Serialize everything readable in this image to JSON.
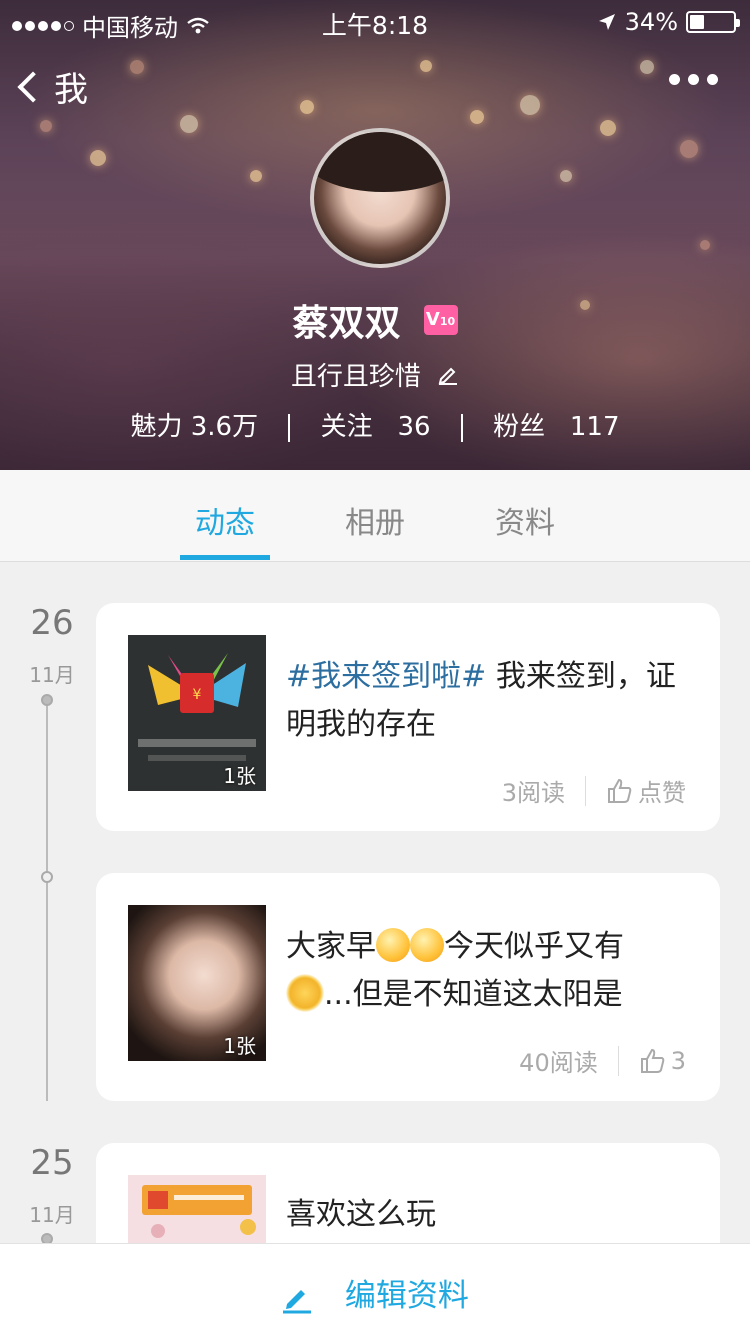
{
  "status_bar": {
    "carrier": "中国移动",
    "time": "上午8:18",
    "battery": "34%",
    "battery_level": 0.34
  },
  "nav": {
    "back_label": "我"
  },
  "profile": {
    "name": "蔡双双",
    "vip_badge": "V10",
    "signature": "且行且珍惜",
    "stats": [
      {
        "label": "魅力",
        "value": "3.6万"
      },
      {
        "label": "关注",
        "value": "36"
      },
      {
        "label": "粉丝",
        "value": "117"
      }
    ]
  },
  "tabs": [
    {
      "label": "动态",
      "active": true
    },
    {
      "label": "相册",
      "active": false
    },
    {
      "label": "资料",
      "active": false
    }
  ],
  "feed": {
    "groups": [
      {
        "day": "26",
        "month": "11月",
        "posts": [
          {
            "hashtag": "#我来签到啦#",
            "text": " 我来签到，证明我的存在",
            "image_count": "1张",
            "reads": "3阅读",
            "like_label": "点赞"
          },
          {
            "text_part1": "大家早",
            "text_part2": "今天似乎又有",
            "text_part3": "...但是不知道这太阳是",
            "image_count": "1张",
            "reads": "40阅读",
            "like_label": "3"
          }
        ]
      },
      {
        "day": "25",
        "month": "11月",
        "posts": [
          {
            "text": "喜欢这么玩"
          }
        ]
      }
    ]
  },
  "bottom_bar": {
    "edit_label": "编辑资料"
  },
  "colors": {
    "accent": "#20a8e0",
    "hashtag": "#2d6ea0",
    "vip": "#ff5fa3"
  }
}
